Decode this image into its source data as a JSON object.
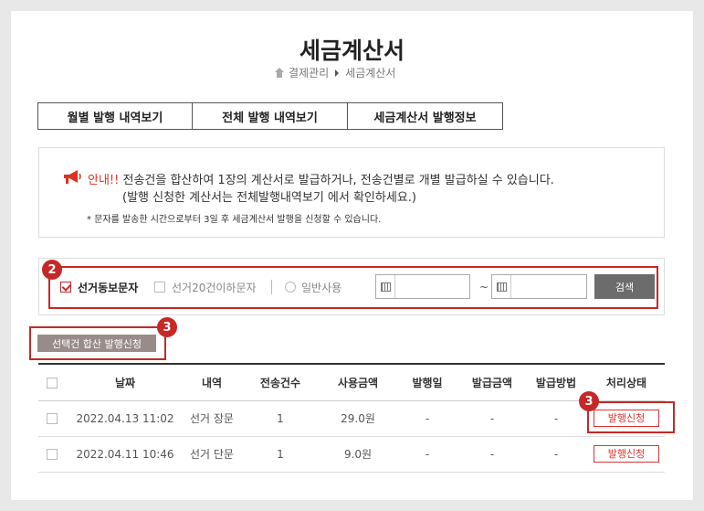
{
  "page": {
    "title": "세금계산서"
  },
  "breadcrumb": {
    "items": [
      "결제관리",
      "세금계산서"
    ]
  },
  "tabs": [
    {
      "label": "월별 발행 내역보기"
    },
    {
      "label": "전체 발행 내역보기"
    },
    {
      "label": "세금계산서 발행정보"
    }
  ],
  "notice": {
    "prefix": "안내!!",
    "line1": "전송건을 합산하여 1장의 계산서로 발급하거나, 전송건별로 개별 발급하실 수 있습니다.",
    "line2": "(발행 신청한 계산서는 전체발행내역보기 에서 확인하세요.)",
    "line3": "* 문자를 발송한 시간으로부터 3일 후 세금계산서 발행을 신청할 수 있습니다."
  },
  "filters": {
    "opt1": {
      "label": "선거동보문자",
      "checked": true
    },
    "opt2": {
      "label": "선거20건이하문자",
      "checked": false
    },
    "opt3": {
      "label": "일반사용",
      "checked": false
    },
    "tilde": "~",
    "search_label": "검색"
  },
  "actions": {
    "batch_label": "선택건 합산 발행신청"
  },
  "badges": {
    "b2": "2",
    "b3a": "3",
    "b3b": "3"
  },
  "table": {
    "headers": [
      "날짜",
      "내역",
      "전송건수",
      "사용금액",
      "발행일",
      "발급금액",
      "발급방법",
      "처리상태"
    ],
    "rows": [
      {
        "date": "2022.04.13 11:02",
        "item": "선거 장문",
        "count": "1",
        "amount": "29.0원",
        "issue_date": "-",
        "issue_amount": "-",
        "method": "-",
        "status": "발행신청"
      },
      {
        "date": "2022.04.11 10:46",
        "item": "선거 단문",
        "count": "1",
        "amount": "9.0원",
        "issue_date": "-",
        "issue_amount": "-",
        "method": "-",
        "status": "발행신청"
      }
    ]
  },
  "colors": {
    "accent": "#c62828",
    "button_gray": "#6c6c6c",
    "batch_button": "#9a8b8b"
  }
}
